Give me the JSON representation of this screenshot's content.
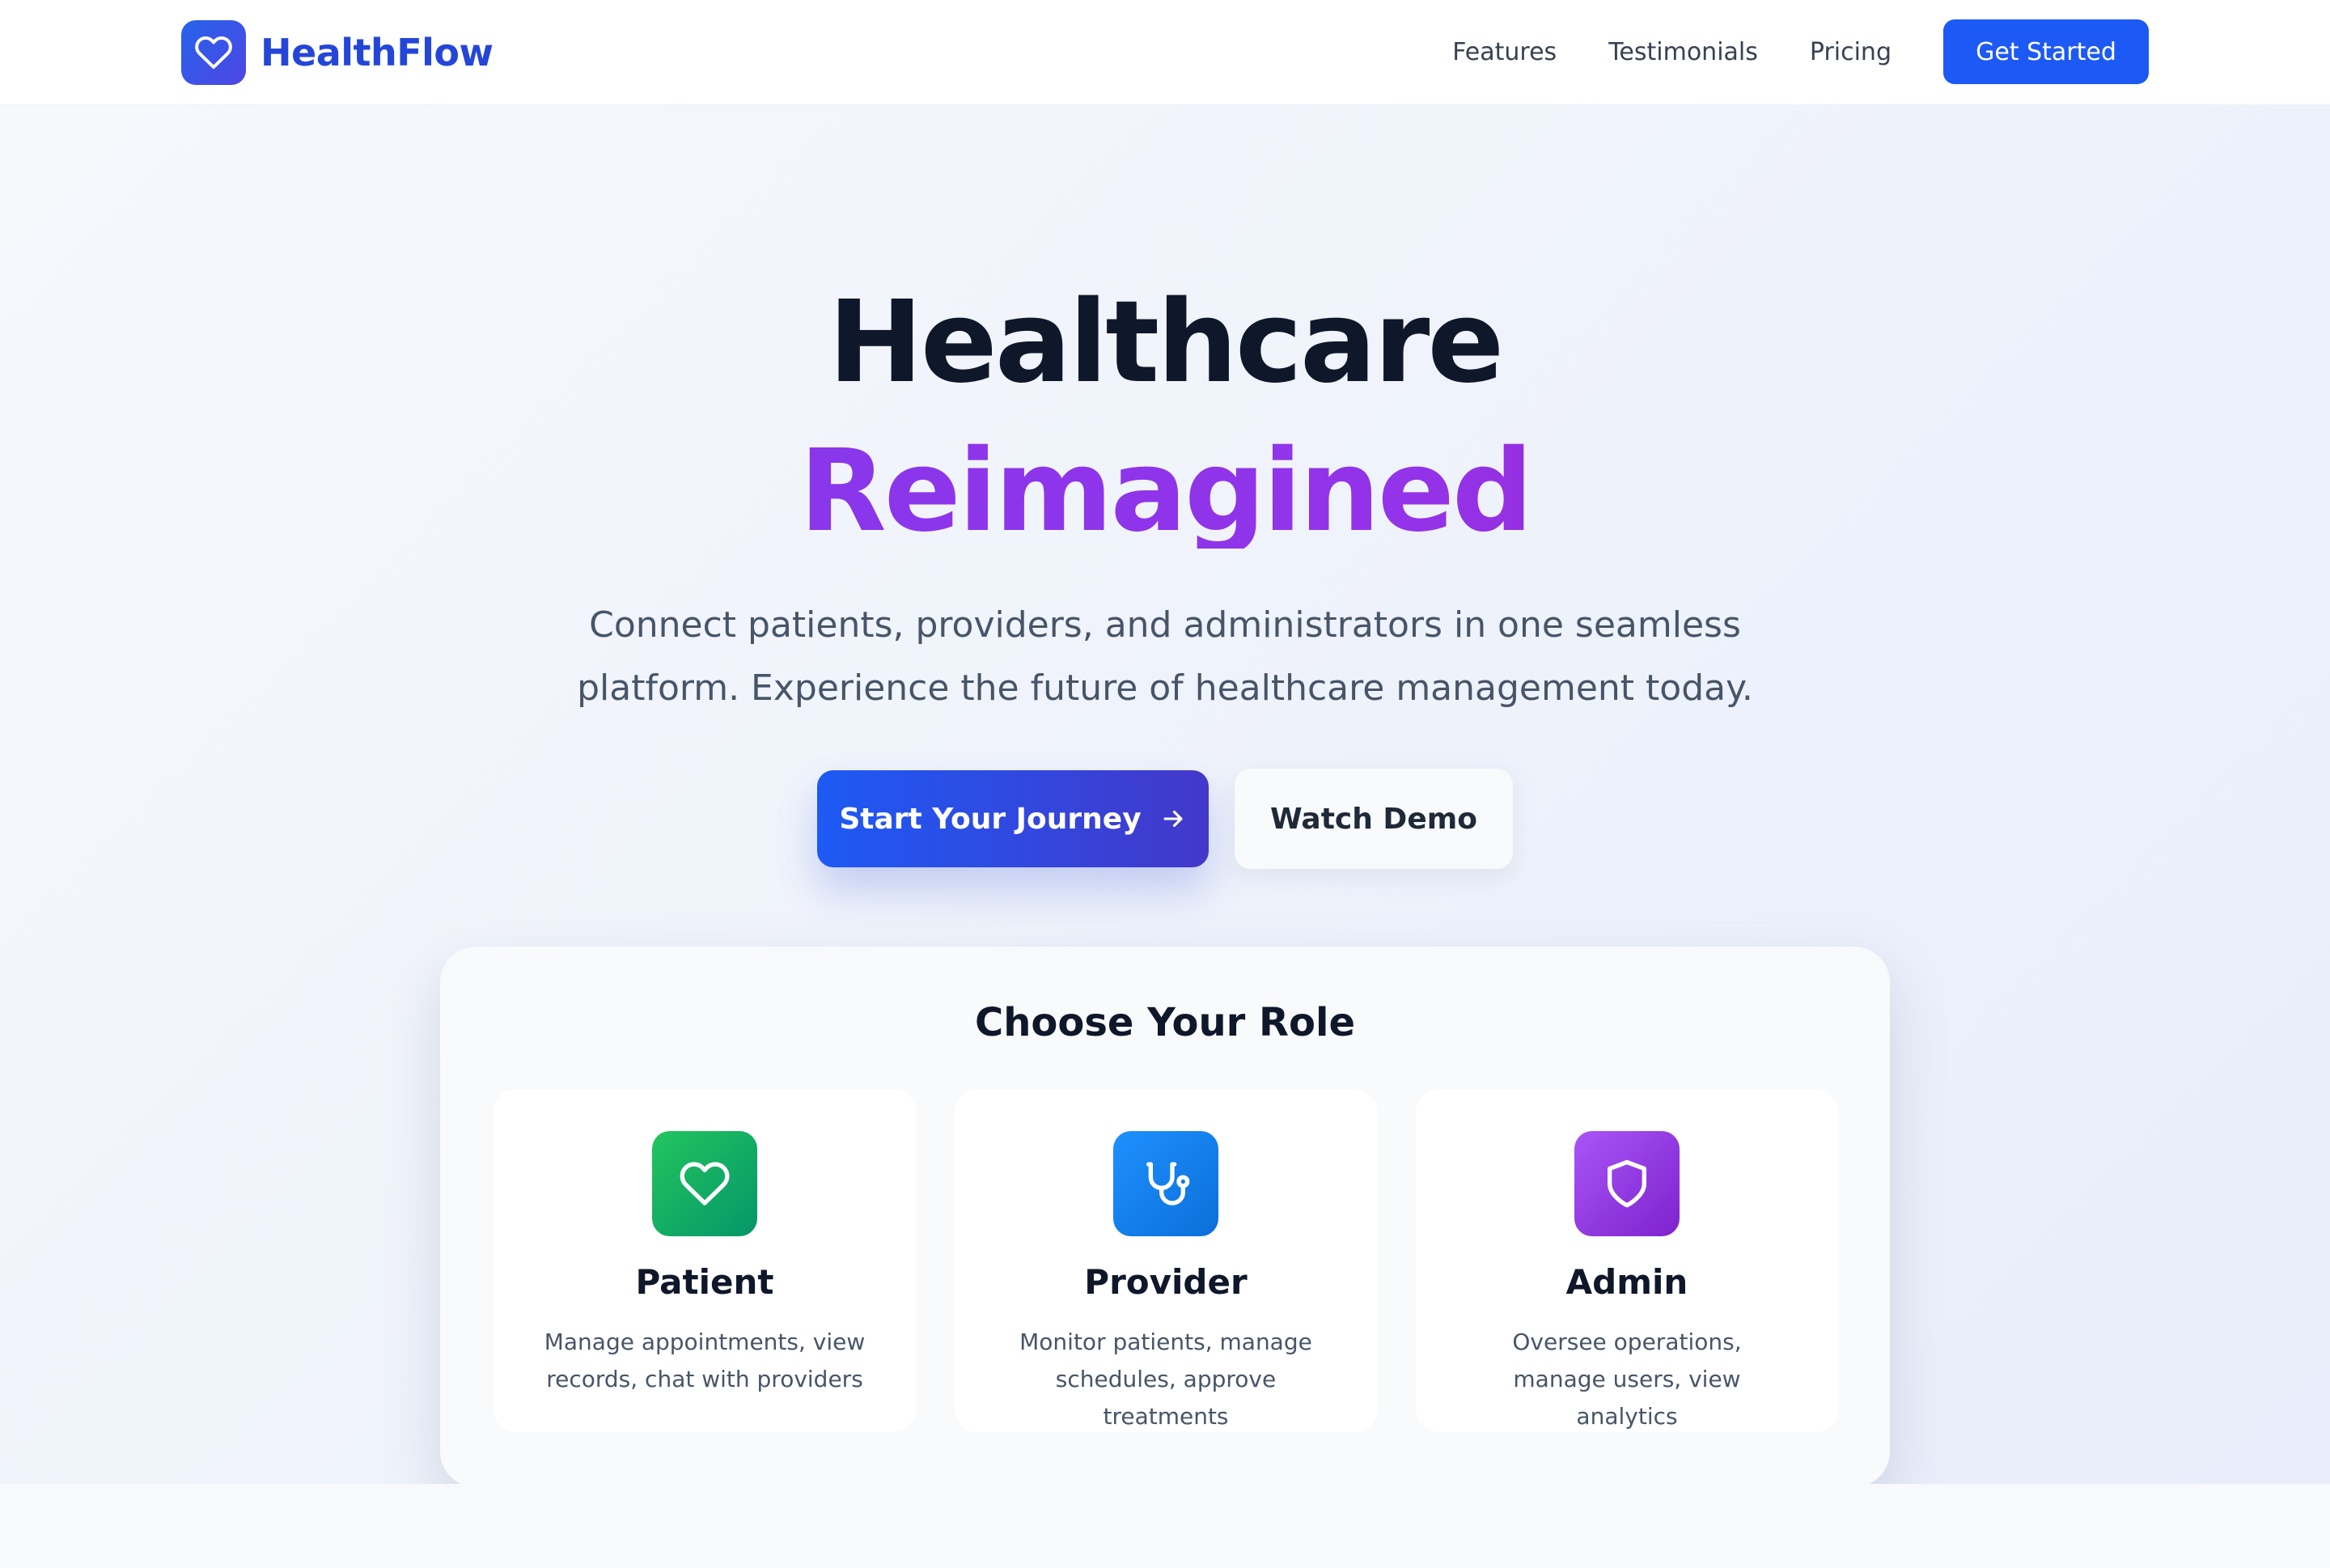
{
  "nav": {
    "brand": "HealthFlow",
    "links": [
      "Features",
      "Testimonials",
      "Pricing"
    ],
    "cta": "Get Started"
  },
  "hero": {
    "title_line1": "Healthcare",
    "title_line2": "Reimagined",
    "subtitle_line1": "Connect patients, providers, and administrators in one seamless",
    "subtitle_line2": "platform. Experience the future of healthcare management today.",
    "primary_cta": "Start Your Journey",
    "secondary_cta": "Watch Demo"
  },
  "roles": {
    "title": "Choose Your Role",
    "items": [
      {
        "name": "Patient",
        "desc": "Manage appointments, view records, chat with providers",
        "icon": "heart-icon",
        "color": "#10b981"
      },
      {
        "name": "Provider",
        "desc": "Monitor patients, manage schedules, approve treatments",
        "icon": "stethoscope-icon",
        "color": "#0b7ee8"
      },
      {
        "name": "Admin",
        "desc": "Oversee operations, manage users, view analytics",
        "icon": "shield-icon",
        "color": "#9333ea"
      }
    ]
  },
  "colors": {
    "accent": "#1d5af5",
    "brand_text": "#2446d8",
    "gradient_title": "#8b2cf0"
  }
}
